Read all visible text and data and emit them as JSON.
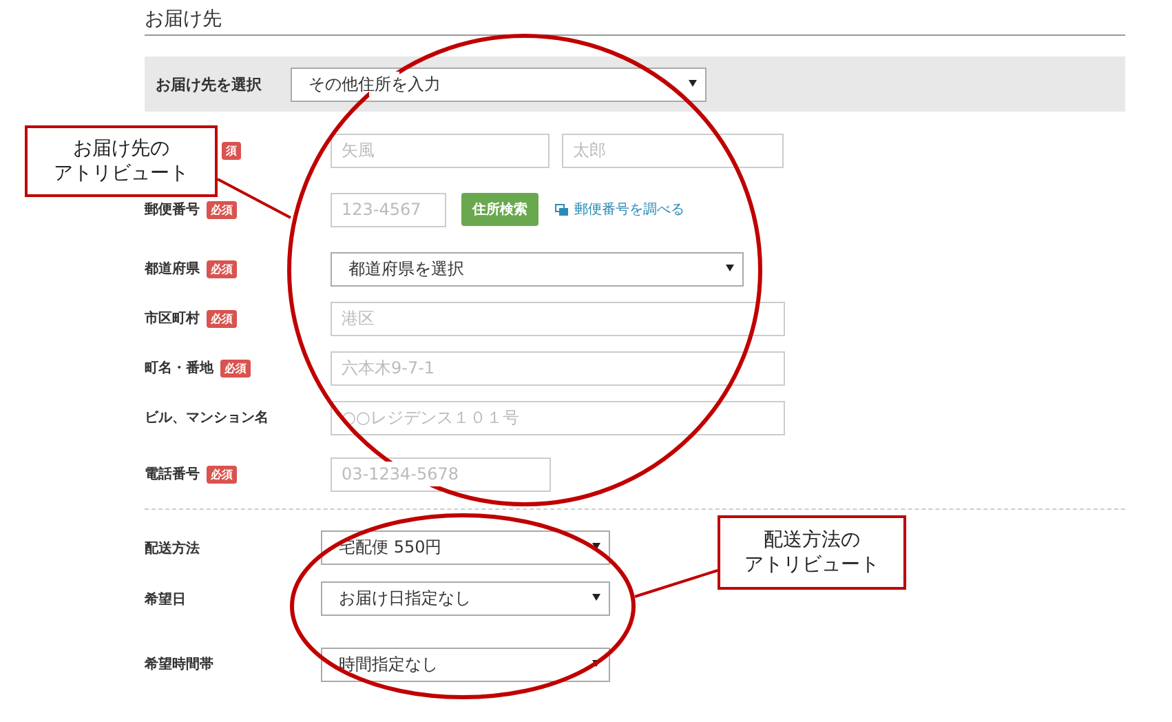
{
  "section_title": "お届け先",
  "destination_select": {
    "label": "お届け先を選択",
    "value": "その他住所を入力"
  },
  "address_fields": [
    {
      "kind": "name",
      "badge": "須",
      "inputs": [
        {
          "placeholder": "矢風"
        },
        {
          "placeholder": "太郎"
        }
      ]
    },
    {
      "kind": "postal",
      "label": "郵便番号",
      "badge": "必須",
      "placeholder": "123-4567",
      "button": "住所検索",
      "link": "郵便番号を調べる"
    },
    {
      "kind": "select",
      "label": "都道府県",
      "badge": "必須",
      "value": "都道府県を選択"
    },
    {
      "kind": "text",
      "label": "市区町村",
      "badge": "必須",
      "placeholder": "港区"
    },
    {
      "kind": "text",
      "label": "町名・番地",
      "badge": "必須",
      "placeholder": "六本木9-7-1"
    },
    {
      "kind": "text",
      "label": "ビル、マンション名",
      "placeholder": "○○レジデンス１０１号"
    },
    {
      "kind": "short",
      "label": "電話番号",
      "badge": "必須",
      "placeholder": "03-1234-5678"
    }
  ],
  "shipping_fields": [
    {
      "label": "配送方法",
      "value": "宅配便 550円"
    },
    {
      "label": "希望日",
      "value": "お届け日指定なし"
    },
    {
      "label": "希望時間帯",
      "value": "時間指定なし"
    }
  ],
  "callouts": [
    {
      "lines": [
        "お届け先の",
        "アトリビュート"
      ]
    },
    {
      "lines": [
        "配送方法の",
        "アトリビュート"
      ]
    }
  ]
}
